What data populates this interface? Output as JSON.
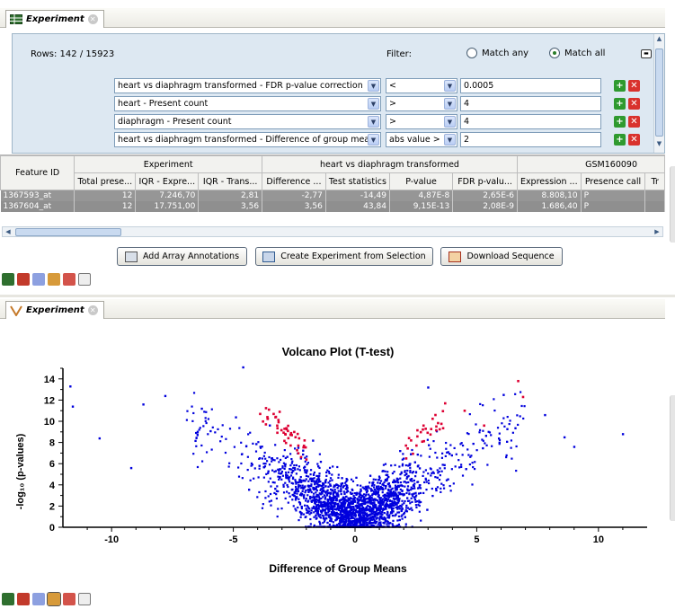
{
  "top_tab": {
    "title": "Experiment"
  },
  "filter": {
    "rows_label": "Rows: 142 / 15923",
    "filter_label": "Filter:",
    "match_any": "Match any",
    "match_all": "Match all",
    "selected_match": "Match all",
    "rows": [
      {
        "column": "heart vs diaphragm transformed - FDR p-value correction",
        "op": "<",
        "value": "0.0005"
      },
      {
        "column": "heart - Present count",
        "op": ">",
        "value": "4"
      },
      {
        "column": "diaphragm - Present count",
        "op": ">",
        "value": "4"
      },
      {
        "column": "heart vs diaphragm transformed - Difference of group means",
        "op": "abs value >",
        "value": "2"
      }
    ]
  },
  "table": {
    "group_headers": [
      "Feature ID",
      "Experiment",
      "heart vs diaphragm transformed",
      "GSM160090"
    ],
    "columns": [
      "Total prese...",
      "IQR - Expre...",
      "IQR - Trans...",
      "Difference ...",
      "Test statistics",
      "P-value",
      "FDR p-valu...",
      "Expression ...",
      "Presence call",
      "Tr"
    ],
    "rows": [
      [
        "1367593_at",
        "12",
        "7.246,70",
        "2,81",
        "-2,77",
        "-14,49",
        "4,87E-8",
        "2,65E-6",
        "8.808,10",
        "P",
        ""
      ],
      [
        "1367604_at",
        "12",
        "17.751,00",
        "3,56",
        "3,56",
        "43,84",
        "9,15E-13",
        "2,08E-9",
        "1.686,40",
        "P",
        ""
      ]
    ]
  },
  "buttons": {
    "add_annotations": "Add Array Annotations",
    "create_experiment": "Create Experiment from Selection",
    "download_sequence": "Download Sequence"
  },
  "bottom_tab": {
    "title": "Experiment"
  },
  "chart_data": {
    "type": "scatter",
    "title": "Volcano Plot (T-test)",
    "xlabel": "Difference of Group Means",
    "ylabel": "-log₁₀ (p-values)",
    "xlim": [
      -12,
      12
    ],
    "ylim": [
      0,
      15
    ],
    "xticks": [
      -10,
      -5,
      0,
      5,
      10
    ],
    "yticks": [
      0,
      2,
      4,
      6,
      8,
      10,
      12,
      14
    ],
    "grid": false,
    "legend": "none",
    "series": [
      {
        "name": "",
        "color": "#0000dd",
        "points": "approx. 15,000 probes; V-shaped cloud centred at x=0, y rising with |x|"
      },
      {
        "name": "",
        "color": "#dd0033",
        "points": "142 filtered probes with |difference| > 2 and FDR < 0.0005"
      }
    ],
    "sample_points": {
      "blue": [
        [
          -11.7,
          13.3
        ],
        [
          -11.6,
          11.4
        ],
        [
          -10.5,
          8.4
        ],
        [
          -8.7,
          11.6
        ],
        [
          -7.8,
          12.4
        ],
        [
          -9.2,
          5.6
        ],
        [
          -6.3,
          11.2
        ],
        [
          -4.6,
          15.1
        ],
        [
          7.8,
          10.6
        ],
        [
          8.6,
          8.5
        ],
        [
          9.0,
          7.6
        ],
        [
          11.0,
          8.8
        ],
        [
          6.1,
          12.5
        ],
        [
          3.0,
          13.2
        ]
      ],
      "red": [
        [
          -3.9,
          10.7
        ],
        [
          -3.2,
          9.6
        ],
        [
          -2.9,
          9.3
        ],
        [
          -2.6,
          8.7
        ],
        [
          -2.3,
          8.4
        ],
        [
          -2.1,
          7.7
        ],
        [
          -2.0,
          6.4
        ],
        [
          2.1,
          6.5
        ],
        [
          2.3,
          8.2
        ],
        [
          2.9,
          9.3
        ],
        [
          3.3,
          10.6
        ],
        [
          3.7,
          11.7
        ],
        [
          4.5,
          11.0
        ],
        [
          5.3,
          9.6
        ],
        [
          6.7,
          13.8
        ],
        [
          6.9,
          12.3
        ],
        [
          -3.1,
          10.9
        ],
        [
          -2.5,
          9.0
        ]
      ]
    }
  }
}
